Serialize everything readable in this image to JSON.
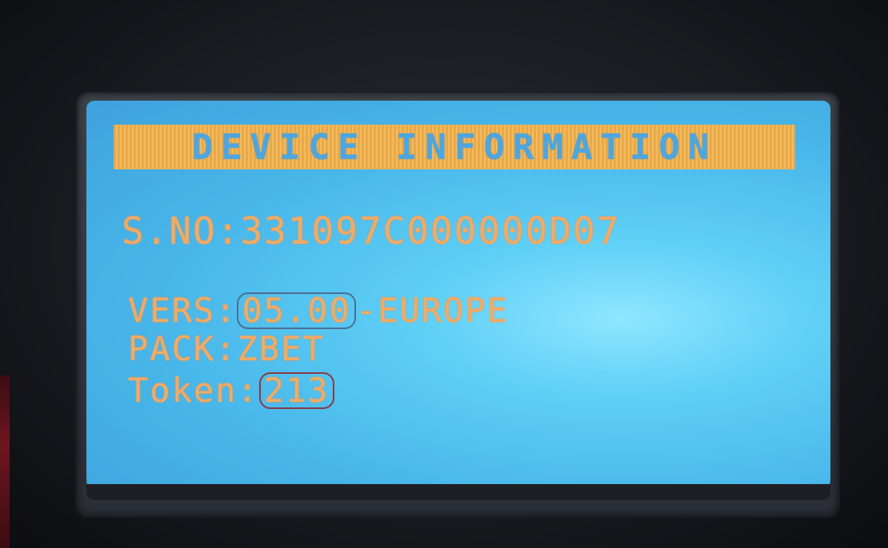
{
  "screen": {
    "title": "DEVICE INFORMATION",
    "serial_line": "S.NO:331097C000000D07",
    "vers_label": "VERS:",
    "vers_value": "05.00",
    "vers_suffix": "-EUROPE",
    "pack_line": "PACK:ZBET",
    "token_label": "Token:",
    "token_value": "213"
  },
  "colors": {
    "lcd_background": "#5fd0f6",
    "lcd_text": "#f2ab63",
    "header_bar": "#efb355",
    "highlight_version": "#4d6e93",
    "highlight_token": "#8a3b45"
  }
}
